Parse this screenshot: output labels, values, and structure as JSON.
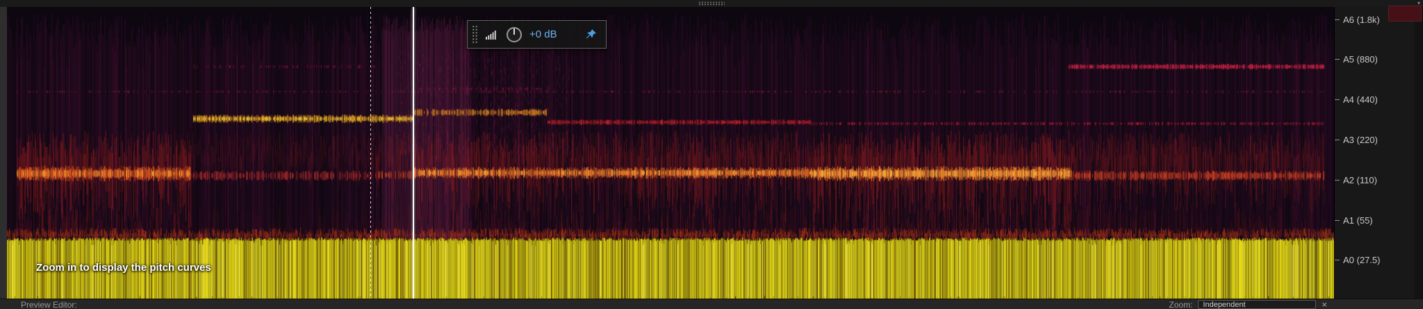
{
  "hud": {
    "gain_value": "+0 dB"
  },
  "spectral": {
    "overlay_message": "Zoom in to display the pitch curves"
  },
  "pitch_ruler": {
    "labels": [
      "A6 (1.8k)",
      "A5 (880)",
      "A4 (440)",
      "A3 (220)",
      "A2 (110)",
      "A1 (55)",
      "A0 (27.5)"
    ]
  },
  "footer": {
    "left_label": "Preview Editor:",
    "zoom_label": "Zoom:",
    "zoom_value": "Independent",
    "close_label": "×"
  },
  "icons": {
    "hud_grip": "grip-dots-icon",
    "hud_meter": "level-meter-icon",
    "hud_knob": "gain-knob-icon",
    "hud_pin": "pin-icon",
    "top_grip": "drag-dots-icon",
    "corner": "menu-triangle-icon"
  },
  "colors": {
    "accent_blue": "#6cb2ef",
    "playhead": "#ffffff",
    "spectral_bg": "#0d0710",
    "olive_band": "#b8a818",
    "scroll_thumb_maroon": "#451016"
  }
}
